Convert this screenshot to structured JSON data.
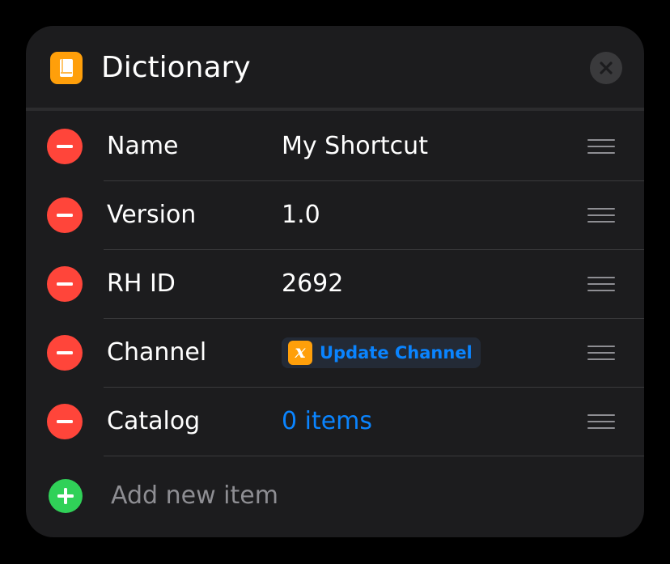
{
  "header": {
    "title": "Dictionary",
    "app_icon": "book-icon",
    "close_icon": "close-icon"
  },
  "rows": [
    {
      "key": "Name",
      "value": "My Shortcut",
      "value_type": "text"
    },
    {
      "key": "Version",
      "value": "1.0",
      "value_type": "text"
    },
    {
      "key": "RH ID",
      "value": "2692",
      "value_type": "text"
    },
    {
      "key": "Channel",
      "value": "Update Channel",
      "value_type": "variable",
      "variable_icon": "x"
    },
    {
      "key": "Catalog",
      "value": "0 items",
      "value_type": "link"
    }
  ],
  "add_item": {
    "label": "Add new item",
    "icon": "plus-icon"
  },
  "colors": {
    "background": "#000000",
    "card": "#1c1c1e",
    "accent_orange": "#ff9f0a",
    "remove_red": "#ff453a",
    "add_green": "#30d158",
    "link_blue": "#0a84ff",
    "secondary_text": "#8e8e93"
  }
}
